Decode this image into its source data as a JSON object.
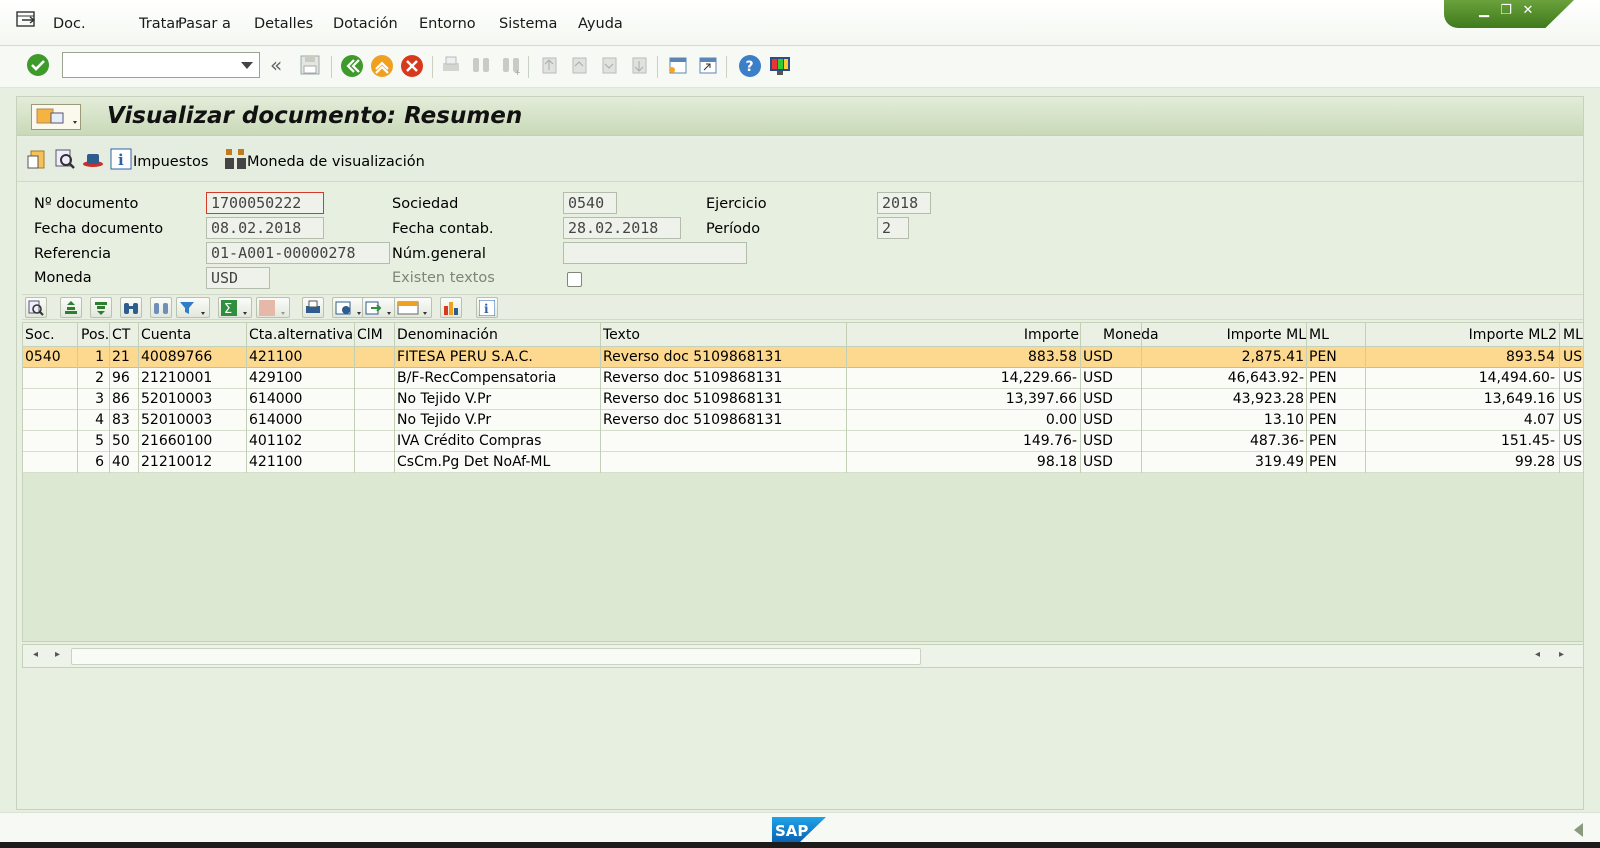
{
  "menu": {
    "items": [
      "Doc.",
      "Tratar",
      "Pasar a",
      "Detalles",
      "Dotación",
      "Entorno",
      "Sistema",
      "Ayuda"
    ]
  },
  "title": "Visualizar documento: Resumen",
  "appbar": {
    "taxes_label": "Impuestos",
    "currency_label": "Moneda de visualización"
  },
  "header": {
    "doc_no_label": "Nº documento",
    "doc_no": "1700050222",
    "company_label": "Sociedad",
    "company": "0540",
    "fiscal_year_label": "Ejercicio",
    "fiscal_year": "2018",
    "doc_date_label": "Fecha documento",
    "doc_date": "08.02.2018",
    "posting_date_label": "Fecha contab.",
    "posting_date": "28.02.2018",
    "period_label": "Período",
    "period": "2",
    "reference_label": "Referencia",
    "reference": "01-A001-00000278",
    "general_no_label": "Núm.general",
    "general_no": "",
    "currency_label": "Moneda",
    "currency": "USD",
    "texts_exist_label": "Existen textos"
  },
  "grid": {
    "columns": [
      "Soc.",
      "Pos.",
      "CT",
      "Cuenta",
      "Cta.alternativa",
      "ClM",
      "Denominación",
      "Texto",
      "Importe",
      "Moneda",
      "Importe ML",
      "ML",
      "Importe ML2",
      "ML"
    ],
    "rows": [
      {
        "soc": "0540",
        "pos": "1",
        "ct": "21",
        "cuenta": "40089766",
        "alt": "421100",
        "clm": "",
        "denom": "FITESA PERU S.A.C.",
        "texto": "Reverso doc 5109868131",
        "importe": "883.58",
        "moneda": "USD",
        "importe_ml": "2,875.41",
        "ml": "PEN",
        "importe_ml2": "893.54",
        "ml2": "US"
      },
      {
        "soc": "",
        "pos": "2",
        "ct": "96",
        "cuenta": "21210001",
        "alt": "429100",
        "clm": "",
        "denom": "B/F-RecCompensatoria",
        "texto": "Reverso doc 5109868131",
        "importe": "14,229.66-",
        "moneda": "USD",
        "importe_ml": "46,643.92-",
        "ml": "PEN",
        "importe_ml2": "14,494.60-",
        "ml2": "US"
      },
      {
        "soc": "",
        "pos": "3",
        "ct": "86",
        "cuenta": "52010003",
        "alt": "614000",
        "clm": "",
        "denom": "No Tejido V.Pr",
        "texto": "Reverso doc 5109868131",
        "importe": "13,397.66",
        "moneda": "USD",
        "importe_ml": "43,923.28",
        "ml": "PEN",
        "importe_ml2": "13,649.16",
        "ml2": "US"
      },
      {
        "soc": "",
        "pos": "4",
        "ct": "83",
        "cuenta": "52010003",
        "alt": "614000",
        "clm": "",
        "denom": "No Tejido V.Pr",
        "texto": "Reverso doc 5109868131",
        "importe": "0.00",
        "moneda": "USD",
        "importe_ml": "13.10",
        "ml": "PEN",
        "importe_ml2": "4.07",
        "ml2": "US"
      },
      {
        "soc": "",
        "pos": "5",
        "ct": "50",
        "cuenta": "21660100",
        "alt": "401102",
        "clm": "",
        "denom": "IVA Crédito Compras",
        "texto": "",
        "importe": "149.76-",
        "moneda": "USD",
        "importe_ml": "487.36-",
        "ml": "PEN",
        "importe_ml2": "151.45-",
        "ml2": "US"
      },
      {
        "soc": "",
        "pos": "6",
        "ct": "40",
        "cuenta": "21210012",
        "alt": "421100",
        "clm": "",
        "denom": "CsCm.Pg Det NoAf-ML",
        "texto": "",
        "importe": "98.18",
        "moneda": "USD",
        "importe_ml": "319.49",
        "ml": "PEN",
        "importe_ml2": "99.28",
        "ml2": "US"
      }
    ]
  },
  "footer": {
    "logo": "SAP"
  },
  "colors": {
    "selected_row": "#fdd98f",
    "title_bg": "#c9d9b8",
    "window_controls": "#4f8a26"
  }
}
